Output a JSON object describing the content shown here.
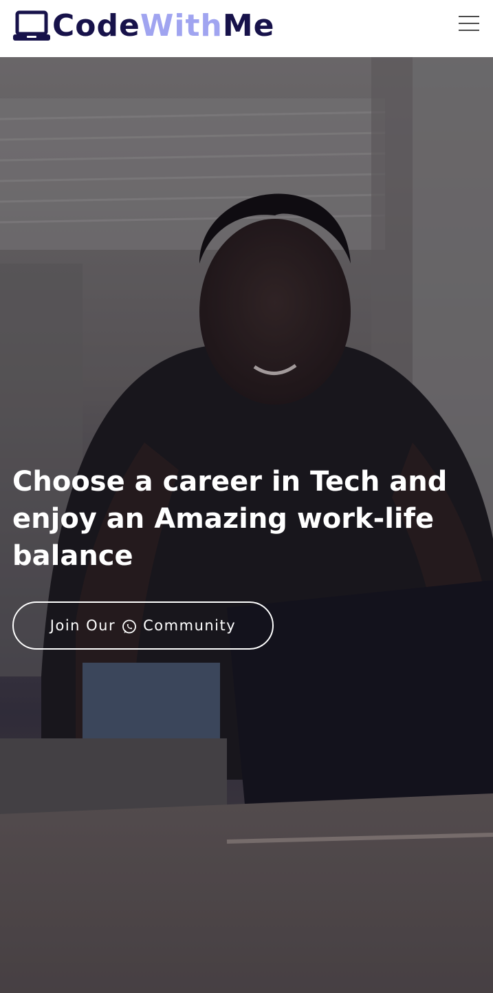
{
  "brand": {
    "part1": "Code",
    "part2": "With",
    "part3": "Me",
    "color_primary": "#17124a",
    "color_accent": "#a0a4f0"
  },
  "nav": {
    "menu_icon": "hamburger-icon"
  },
  "hero": {
    "title": "Choose a career in Tech and enjoy an Amazing work-life balance",
    "cta": {
      "text_before": "Join Our",
      "icon": "whatsapp-icon",
      "text_after": "Community"
    }
  }
}
